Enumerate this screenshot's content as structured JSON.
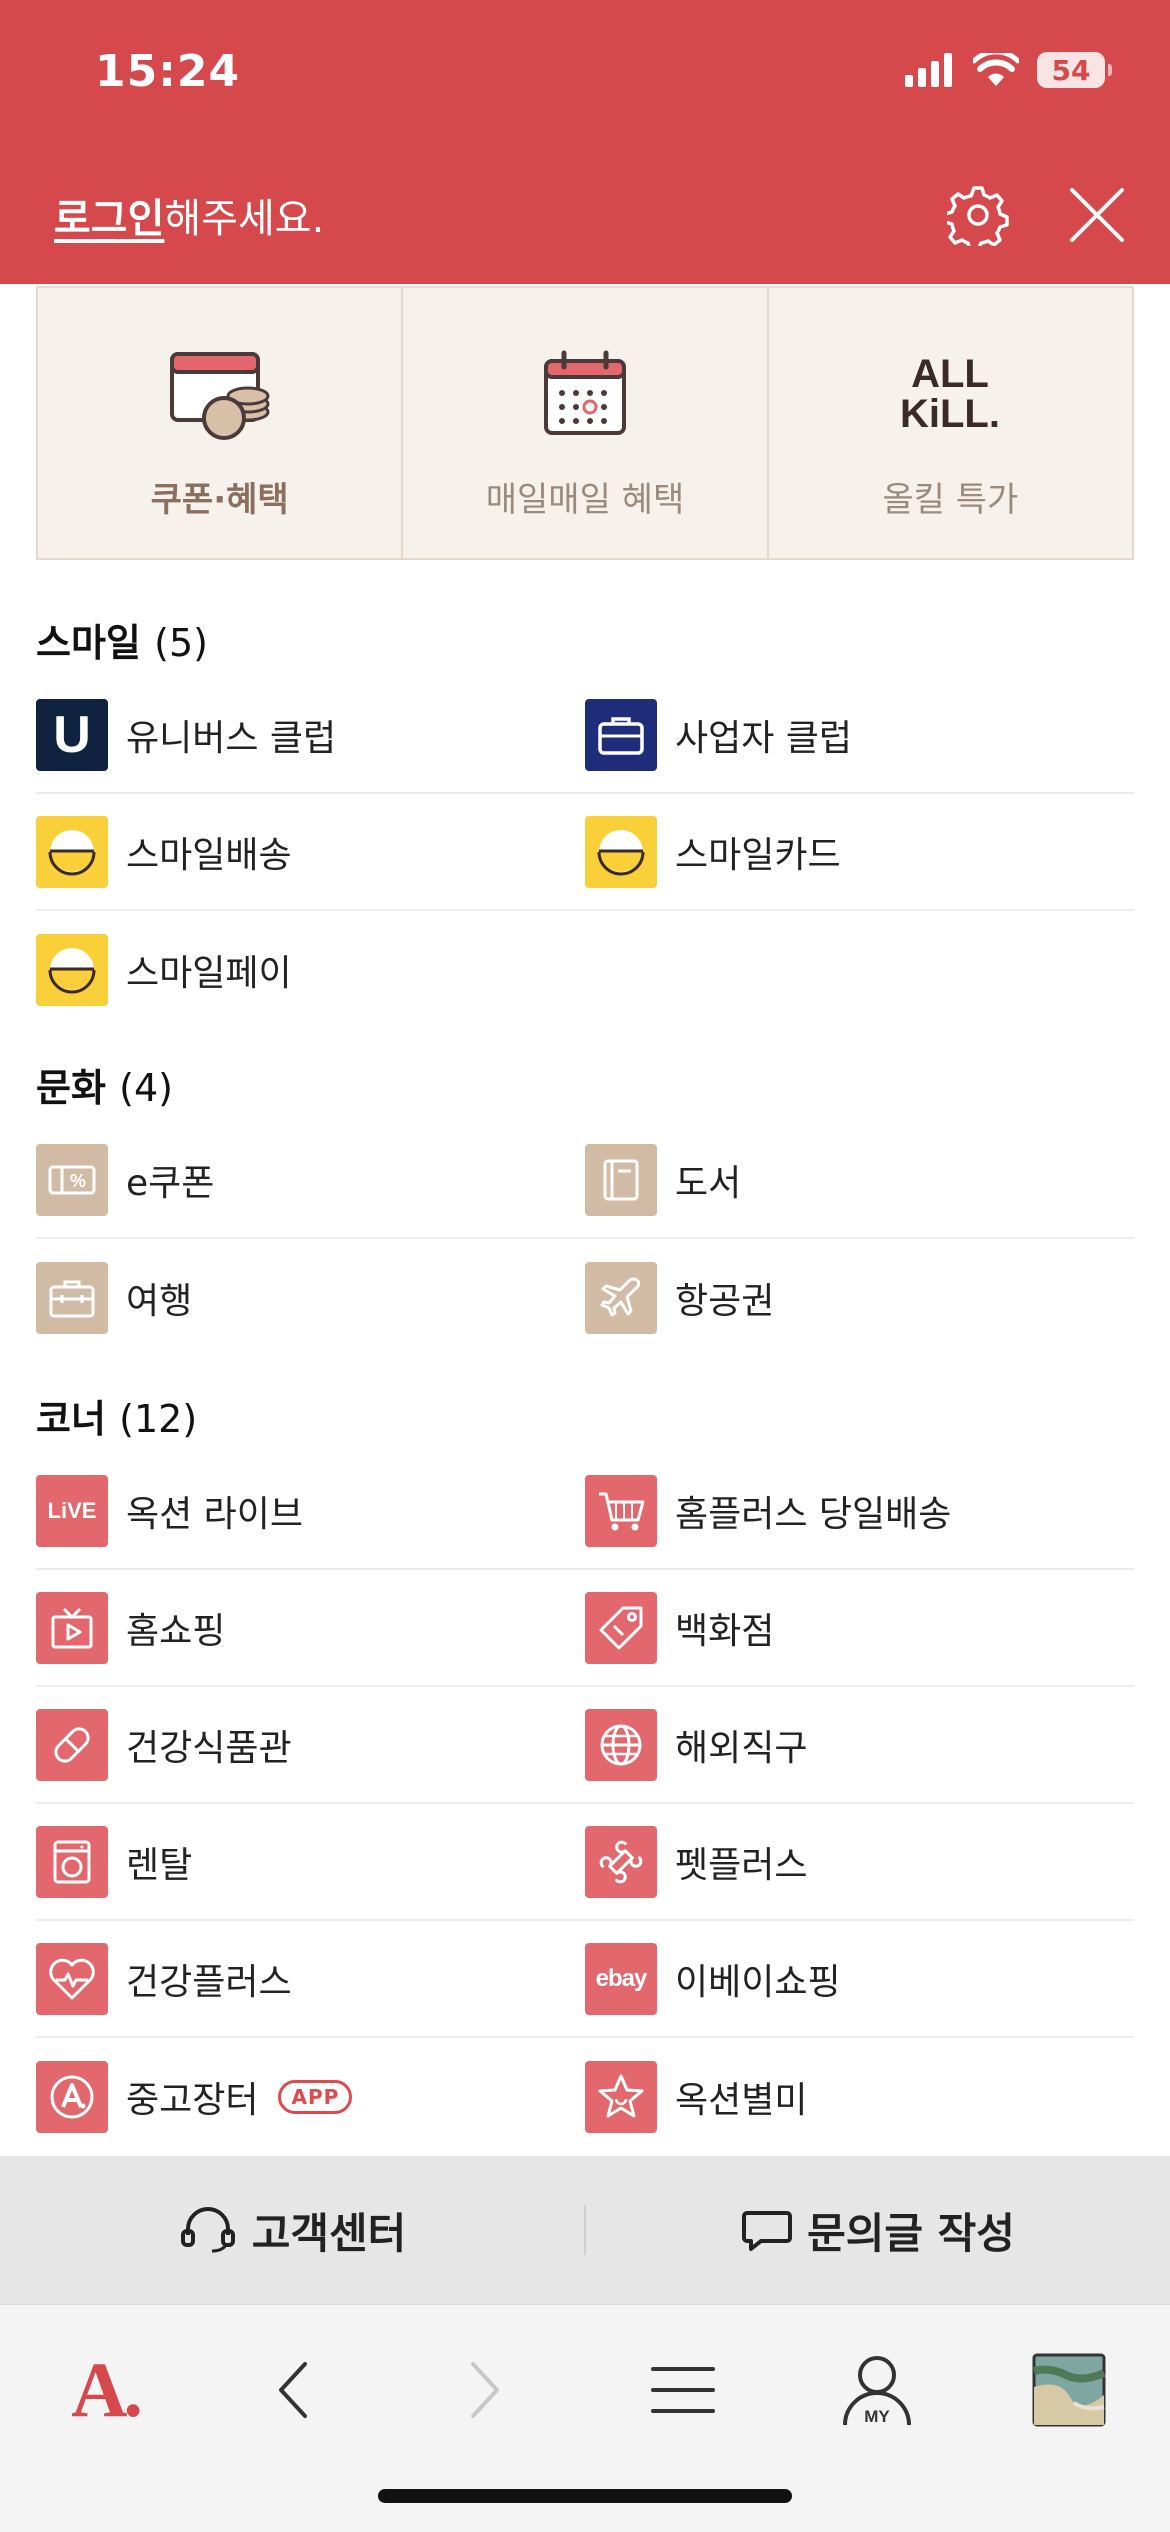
{
  "status_bar": {
    "time": "15:24",
    "battery": "54"
  },
  "header": {
    "login_link": "로그인",
    "login_suffix": "해주세요."
  },
  "quick_menu": [
    {
      "label": "쿠폰·혜택",
      "icon": "coupon-wallet-icon"
    },
    {
      "label": "매일매일 혜택",
      "icon": "calendar-icon"
    },
    {
      "label": "올킬 특가",
      "icon": "allkill-logo",
      "logo_line1": "ALL",
      "logo_line2": "KiLL."
    }
  ],
  "sections": {
    "smile": {
      "title": "스마일",
      "count": "(5)",
      "items": [
        {
          "label": "유니버스 클럽",
          "icon": "universe-club-icon",
          "icon_text": "U"
        },
        {
          "label": "사업자 클럽",
          "icon": "briefcase-icon"
        },
        {
          "label": "스마일배송",
          "icon": "smile-icon"
        },
        {
          "label": "스마일카드",
          "icon": "smile-icon"
        },
        {
          "label": "스마일페이",
          "icon": "smile-icon"
        }
      ]
    },
    "culture": {
      "title": "문화",
      "count": "(4)",
      "items": [
        {
          "label": "e쿠폰",
          "icon": "ecoupon-icon"
        },
        {
          "label": "도서",
          "icon": "book-icon"
        },
        {
          "label": "여행",
          "icon": "suitcase-icon"
        },
        {
          "label": "항공권",
          "icon": "airplane-icon"
        }
      ]
    },
    "corner": {
      "title": "코너",
      "count": "(12)",
      "items": [
        {
          "label": "옥션 라이브",
          "icon": "live-icon",
          "icon_text": "LiVE"
        },
        {
          "label": "홈플러스 당일배송",
          "icon": "cart-icon"
        },
        {
          "label": "홈쇼핑",
          "icon": "tv-icon"
        },
        {
          "label": "백화점",
          "icon": "tag-icon"
        },
        {
          "label": "건강식품관",
          "icon": "pill-icon"
        },
        {
          "label": "해외직구",
          "icon": "globe-icon"
        },
        {
          "label": "렌탈",
          "icon": "washer-icon"
        },
        {
          "label": "펫플러스",
          "icon": "bone-icon"
        },
        {
          "label": "건강플러스",
          "icon": "heartbeat-icon"
        },
        {
          "label": "이베이쇼핑",
          "icon": "ebay-icon",
          "icon_text": "ebay"
        },
        {
          "label": "중고장터",
          "icon": "auction-a-icon",
          "badge": "APP"
        },
        {
          "label": "옥션별미",
          "icon": "star-icon"
        }
      ]
    }
  },
  "footer": {
    "customer_center": "고객센터",
    "inquiry": "문의글 작성"
  },
  "browser_bar": {
    "home_logo": "A.",
    "my_label": "MY"
  },
  "colors": {
    "header_red": "#d5494c",
    "navy": "#0f2340",
    "smile_yellow": "#f9cf3a",
    "culture_tan": "#d2bba4",
    "corner_pink": "#e2686d"
  }
}
